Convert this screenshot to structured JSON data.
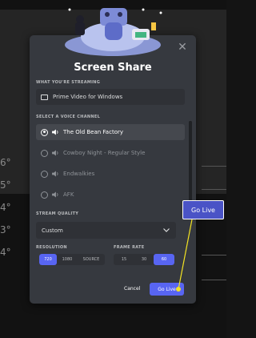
{
  "background": {
    "temps": [
      "6°",
      "5°",
      "4°",
      "3°",
      "4°"
    ]
  },
  "modal": {
    "title": "Screen Share",
    "close_icon": "close-icon",
    "streaming_label": "WHAT YOU'RE STREAMING",
    "streaming_app": "Prime Video for Windows",
    "voice_label": "SELECT A VOICE CHANNEL",
    "channels": [
      {
        "label": "The Old Bean Factory",
        "selected": true
      },
      {
        "label": "Cowboy Night - Regular Style",
        "selected": false
      },
      {
        "label": "Endwalkies",
        "selected": false
      },
      {
        "label": "AFK",
        "selected": false
      }
    ],
    "quality_label": "STREAM QUALITY",
    "quality_value": "Custom",
    "resolution_label": "RESOLUTION",
    "resolution_options": [
      "720",
      "1080",
      "SOURCE"
    ],
    "resolution_selected": "720",
    "framerate_label": "FRAME RATE",
    "framerate_options": [
      "15",
      "30",
      "60"
    ],
    "framerate_selected": "60",
    "cancel_label": "Cancel",
    "golive_label": "Go Live"
  },
  "annotation": {
    "callout_label": "Go Live"
  },
  "colors": {
    "accent": "#5865f2",
    "callout": "#4a53c6",
    "pointer": "#f3e323"
  }
}
